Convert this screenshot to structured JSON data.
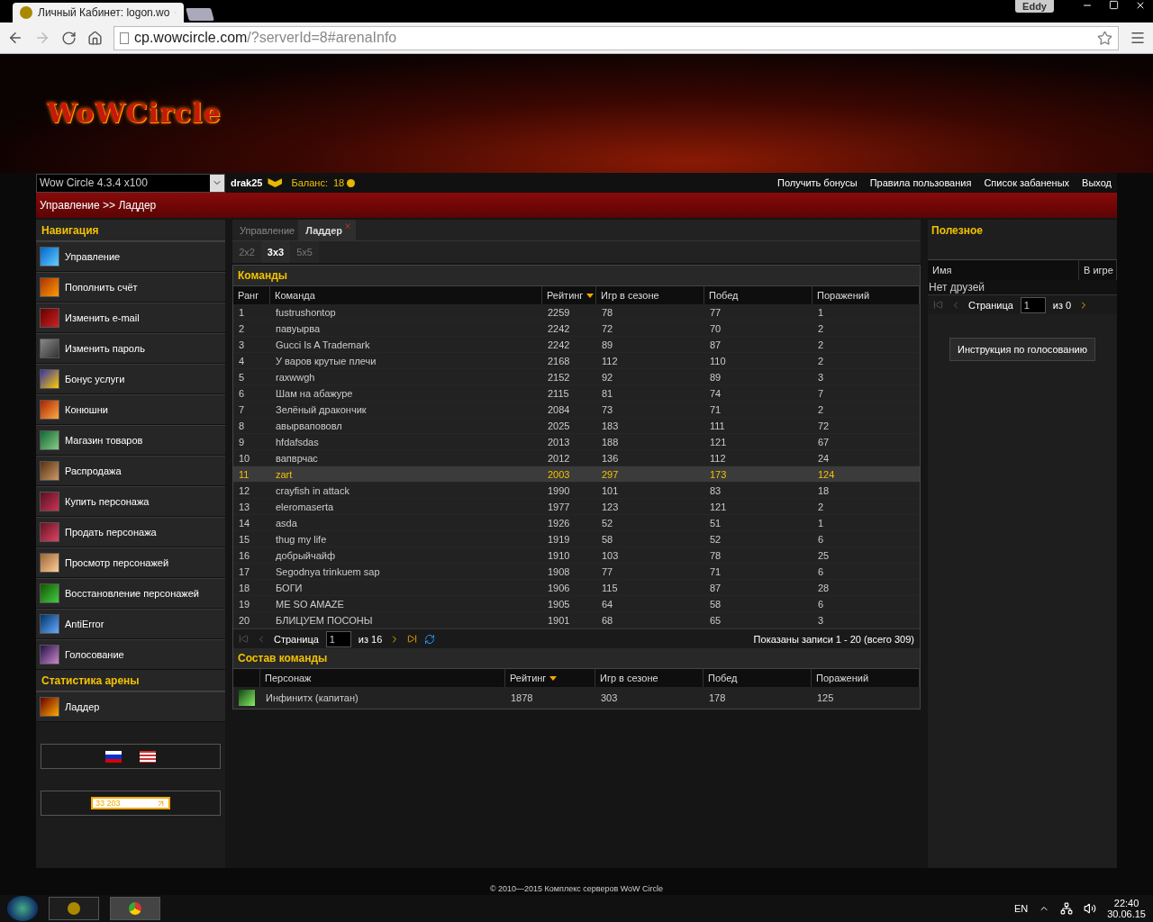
{
  "browser": {
    "tab_title": "Личный Кабинет: logon.wo",
    "user": "Eddy",
    "url_host": "cp.wowcircle.com",
    "url_path": "/?serverId=8#arenaInfo"
  },
  "logo": "WoWCircle",
  "topbar": {
    "server": "Wow Circle 4.3.4 x100",
    "user": "drak25",
    "balance_label": "Баланс:",
    "balance": "18",
    "links": [
      "Получить бонусы",
      "Правила пользования",
      "Список забаненых",
      "Выход"
    ]
  },
  "breadcrumb": "Управление >> Ладдер",
  "nav": {
    "title": "Навигация",
    "items": [
      "Управление",
      "Пополнить счёт",
      "Изменить e-mail",
      "Изменить пароль",
      "Бонус услуги",
      "Конюшни",
      "Магазин товаров",
      "Распродажа",
      "Купить персонажа",
      "Продать персонажа",
      "Просмотр персонажей",
      "Восстановление персонажей",
      "AntiError",
      "Голосование"
    ],
    "section": "Статистика арены",
    "section_items": [
      "Ладдер"
    ],
    "counter": "33 203"
  },
  "tabs": [
    {
      "label": "Управление",
      "selected": false,
      "closable": false
    },
    {
      "label": "Ладдер",
      "selected": true,
      "closable": true
    }
  ],
  "subtabs": [
    {
      "label": "2x2",
      "selected": false
    },
    {
      "label": "3x3",
      "selected": true
    },
    {
      "label": "5x5",
      "selected": false
    }
  ],
  "teams": {
    "title": "Команды",
    "columns": [
      {
        "label": "Ранг",
        "sorted": false
      },
      {
        "label": "Команда",
        "sorted": false
      },
      {
        "label": "Рейтинг",
        "sorted": true
      },
      {
        "label": "Игр в сезоне",
        "sorted": false
      },
      {
        "label": "Побед",
        "sorted": false
      },
      {
        "label": "Поражений",
        "sorted": false
      }
    ],
    "rows": [
      {
        "cells": [
          "1",
          "fustrushontop",
          "2259",
          "78",
          "77",
          "1"
        ],
        "selected": false
      },
      {
        "cells": [
          "2",
          "павуырва",
          "2242",
          "72",
          "70",
          "2"
        ],
        "selected": false
      },
      {
        "cells": [
          "3",
          "Gucci Is A Trademark",
          "2242",
          "89",
          "87",
          "2"
        ],
        "selected": false
      },
      {
        "cells": [
          "4",
          "У варов крутые плечи",
          "2168",
          "112",
          "110",
          "2"
        ],
        "selected": false
      },
      {
        "cells": [
          "5",
          "raxwwgh",
          "2152",
          "92",
          "89",
          "3"
        ],
        "selected": false
      },
      {
        "cells": [
          "6",
          "Шам на абажуре",
          "2115",
          "81",
          "74",
          "7"
        ],
        "selected": false
      },
      {
        "cells": [
          "7",
          "Зелёный дракончик",
          "2084",
          "73",
          "71",
          "2"
        ],
        "selected": false
      },
      {
        "cells": [
          "8",
          "авырвапововл",
          "2025",
          "183",
          "111",
          "72"
        ],
        "selected": false
      },
      {
        "cells": [
          "9",
          "hfdafsdas",
          "2013",
          "188",
          "121",
          "67"
        ],
        "selected": false
      },
      {
        "cells": [
          "10",
          "вапврчас",
          "2012",
          "136",
          "112",
          "24"
        ],
        "selected": false
      },
      {
        "cells": [
          "11",
          "zart",
          "2003",
          "297",
          "173",
          "124"
        ],
        "selected": true
      },
      {
        "cells": [
          "12",
          "crayfish in attack",
          "1990",
          "101",
          "83",
          "18"
        ],
        "selected": false
      },
      {
        "cells": [
          "13",
          "eleromaserta",
          "1977",
          "123",
          "121",
          "2"
        ],
        "selected": false
      },
      {
        "cells": [
          "14",
          "asda",
          "1926",
          "52",
          "51",
          "1"
        ],
        "selected": false
      },
      {
        "cells": [
          "15",
          "thug my life",
          "1919",
          "58",
          "52",
          "6"
        ],
        "selected": false
      },
      {
        "cells": [
          "16",
          "добрыйчайф",
          "1910",
          "103",
          "78",
          "25"
        ],
        "selected": false
      },
      {
        "cells": [
          "17",
          "Segodnya trinkuem sap",
          "1908",
          "77",
          "71",
          "6"
        ],
        "selected": false
      },
      {
        "cells": [
          "18",
          "БОГИ",
          "1906",
          "115",
          "87",
          "28"
        ],
        "selected": false
      },
      {
        "cells": [
          "19",
          "ME SO AMAZE",
          "1905",
          "64",
          "58",
          "6"
        ],
        "selected": false
      },
      {
        "cells": [
          "20",
          "БЛИЦУЕМ ПОСОНЫ",
          "1901",
          "68",
          "65",
          "3"
        ],
        "selected": false
      }
    ],
    "pager": {
      "label": "Страница",
      "page": "1",
      "of": "из 16",
      "summary": "Показаны записи 1 - 20 (всего 309)"
    }
  },
  "roster": {
    "title": "Состав команды",
    "columns": [
      {
        "label": "Персонаж",
        "sorted": false
      },
      {
        "label": "Рейтинг",
        "sorted": true
      },
      {
        "label": "Игр в сезоне",
        "sorted": false
      },
      {
        "label": "Побед",
        "sorted": false
      },
      {
        "label": "Поражений",
        "sorted": false
      }
    ],
    "rows": [
      {
        "cells": [
          "Инфинитх (капитан)",
          "1878",
          "303",
          "178",
          "125"
        ]
      }
    ]
  },
  "useful": {
    "title": "Полезное",
    "columns": [
      "Имя",
      "В игре"
    ],
    "empty": "Нет друзей",
    "pager": {
      "label": "Страница",
      "page": "1",
      "of": "из 0"
    },
    "button": "Инструкция по голосованию"
  },
  "footer": "© 2010—2015 Комплекс серверов WoW Circle",
  "taskbar": {
    "lang": "EN",
    "time": "22:40",
    "date": "30.06.15"
  }
}
